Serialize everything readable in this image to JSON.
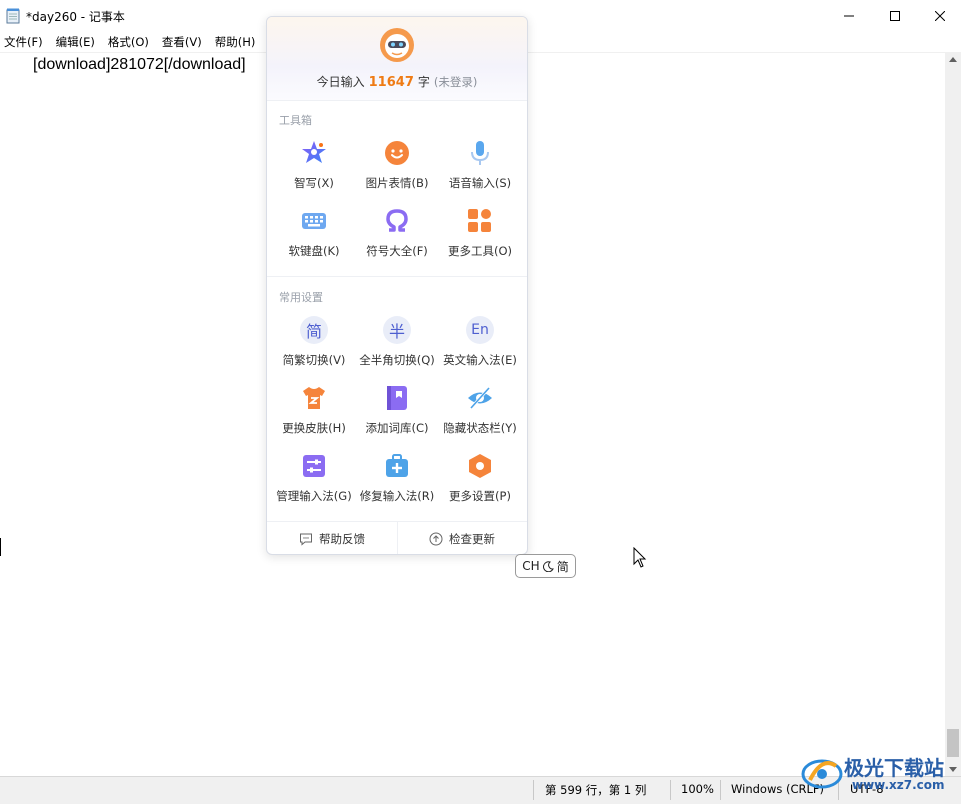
{
  "window": {
    "title": "*day260 - 记事本",
    "menu": [
      "文件(F)",
      "编辑(E)",
      "格式(O)",
      "查看(V)",
      "帮助(H)"
    ]
  },
  "editor": {
    "line1": "[download]281072[/download]"
  },
  "statusbar": {
    "position": "第 599 行，第 1 列",
    "zoom": "100%",
    "line_ending": "Windows (CRLF)",
    "encoding": "UTF-8"
  },
  "ime": {
    "stat_prefix": "今日输入",
    "count": "11647",
    "stat_unit": "字",
    "login_status": "(未登录)",
    "toolbox_title": "工具箱",
    "tools": [
      {
        "label": "智写(X)",
        "icon": "smart-write-icon"
      },
      {
        "label": "图片表情(B)",
        "icon": "emoji-icon"
      },
      {
        "label": "语音输入(S)",
        "icon": "microphone-icon"
      },
      {
        "label": "软键盘(K)",
        "icon": "keyboard-icon"
      },
      {
        "label": "符号大全(F)",
        "icon": "omega-icon"
      },
      {
        "label": "更多工具(O)",
        "icon": "apps-grid-icon"
      }
    ],
    "settings_title": "常用设置",
    "settings": [
      {
        "label": "简繁切换(V)",
        "glyph": "简",
        "icon": "simplified-traditional-icon"
      },
      {
        "label": "全半角切换(Q)",
        "glyph": "半",
        "icon": "half-width-icon"
      },
      {
        "label": "英文输入法(E)",
        "glyph": "En",
        "icon": "english-icon"
      },
      {
        "label": "更换皮肤(H)",
        "icon": "skin-shirt-icon"
      },
      {
        "label": "添加词库(C)",
        "icon": "dictionary-icon"
      },
      {
        "label": "隐藏状态栏(Y)",
        "icon": "hide-eye-icon"
      },
      {
        "label": "管理输入法(G)",
        "icon": "manage-sliders-icon"
      },
      {
        "label": "修复输入法(R)",
        "icon": "repair-kit-icon"
      },
      {
        "label": "更多设置(P)",
        "icon": "settings-hexagon-icon"
      }
    ],
    "footer": {
      "help": "帮助反馈",
      "update": "检查更新"
    },
    "chip": {
      "lang": "CH",
      "mode": "简"
    }
  },
  "watermark": {
    "text": "极光下载站",
    "url": "www.xz7.com"
  },
  "colors": {
    "accent_orange": "#ef7b14",
    "ime_blue": "#4e5fd0",
    "watermark_blue": "#2a5fa8"
  }
}
